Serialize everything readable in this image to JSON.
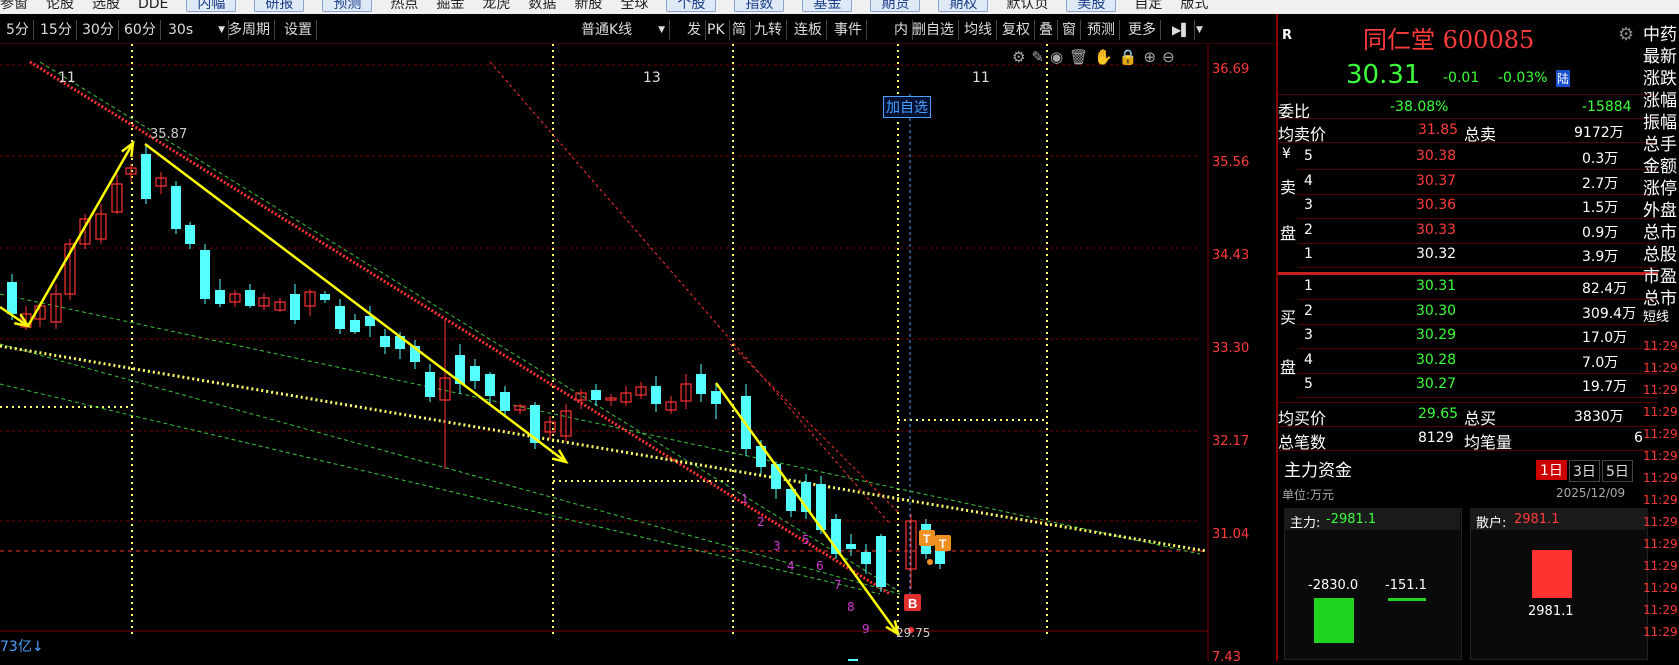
{
  "top_menu": [
    "参窗",
    "论股",
    "选股",
    "DDE",
    "内幅",
    "研报",
    "预测",
    "热点",
    "掘金",
    "龙虎",
    "数据",
    "新股",
    "全球",
    "个股",
    "指数",
    "基金",
    "期货",
    "期权",
    "默认页",
    "美股",
    "自定",
    "版式"
  ],
  "toolbar": {
    "periods": [
      "5分",
      "15分",
      "30分",
      "60分",
      "30s"
    ],
    "multi_period": "多周期",
    "settings": "设置",
    "kline_type": "普通K线",
    "tools": [
      "发",
      "PK",
      "简",
      "九转",
      "连板",
      "事件",
      "内",
      "删自选",
      "均线",
      "复权",
      "叠",
      "窗",
      "预测",
      "更多"
    ]
  },
  "chart": {
    "price_axis": [
      "36.69",
      "35.56",
      "34.43",
      "33.30",
      "32.17",
      "31.04",
      "7.43"
    ],
    "date_labels": [
      "11",
      "13",
      "11"
    ],
    "high_label": "35.87",
    "low_label": "29.75",
    "add_watchlist": "加自选",
    "bottom_label": "73亿↓",
    "seq_numbers": [
      "1",
      "2",
      "3",
      "4",
      "5",
      "6",
      "7",
      "8",
      "9"
    ],
    "markers": {
      "buy": "B",
      "t1": "T",
      "t2": "T"
    },
    "colors": {
      "up": "#ff3232",
      "down": "#54ffff",
      "trend": "#ffff00",
      "grid": "#7a0000"
    }
  },
  "stock": {
    "name": "同仁堂",
    "code": "600085",
    "r_label": "R",
    "price": "30.31",
    "change": "-0.01",
    "change_pct": "-0.03%",
    "exchange_tag": "陆",
    "wei_bi_label": "委比",
    "wei_bi": "-38.08%",
    "wei_cha": "-15884",
    "avg_sell_label": "均卖价",
    "avg_sell": "31.85",
    "total_sell_label": "总卖",
    "total_sell": "9172万",
    "sell_side_labels": [
      "¥",
      "卖",
      "盘"
    ],
    "asks": [
      {
        "lv": "5",
        "price": "30.38",
        "vol": "0.3万"
      },
      {
        "lv": "4",
        "price": "30.37",
        "vol": "2.7万"
      },
      {
        "lv": "3",
        "price": "30.36",
        "vol": "1.5万"
      },
      {
        "lv": "2",
        "price": "30.33",
        "vol": "0.9万"
      },
      {
        "lv": "1",
        "price": "30.32",
        "vol": "3.9万"
      }
    ],
    "buy_side_labels": [
      "买",
      "盘"
    ],
    "bids": [
      {
        "lv": "1",
        "price": "30.31",
        "vol": "82.4万"
      },
      {
        "lv": "2",
        "price": "30.30",
        "vol": "309.4万"
      },
      {
        "lv": "3",
        "price": "30.29",
        "vol": "17.0万"
      },
      {
        "lv": "4",
        "price": "30.28",
        "vol": "7.0万"
      },
      {
        "lv": "5",
        "price": "30.27",
        "vol": "19.7万"
      }
    ],
    "avg_buy_label": "均买价",
    "avg_buy": "29.65",
    "total_buy_label": "总买",
    "total_buy": "3830万",
    "trades_label": "总笔数",
    "trades": "8129",
    "avg_vol_label": "均笔量",
    "avg_vol": "6"
  },
  "capital": {
    "title": "主力资金",
    "tabs": [
      "1日",
      "3日",
      "5日"
    ],
    "unit": "单位:万元",
    "date": "2025/12/09",
    "main_label": "主力:",
    "main_value": "-2981.1",
    "retail_label": "散户:",
    "retail_value": "2981.1",
    "bar1": "-2830.0",
    "bar2": "-151.1",
    "bar3": "2981.1"
  },
  "side_labels": [
    "中药",
    "最新",
    "涨跌",
    "涨幅",
    "振幅",
    "总手",
    "金额",
    "涨停",
    "外盘",
    "总市",
    "总股",
    "市盈",
    "总市",
    "短线"
  ],
  "tick_times": [
    "11:29",
    "11:29",
    "11:29",
    "11:29",
    "11:29",
    "11:29",
    "11:29",
    "11:29",
    "11:29",
    "11:29",
    "11:29",
    "11:29",
    "11:29",
    "11:29"
  ]
}
